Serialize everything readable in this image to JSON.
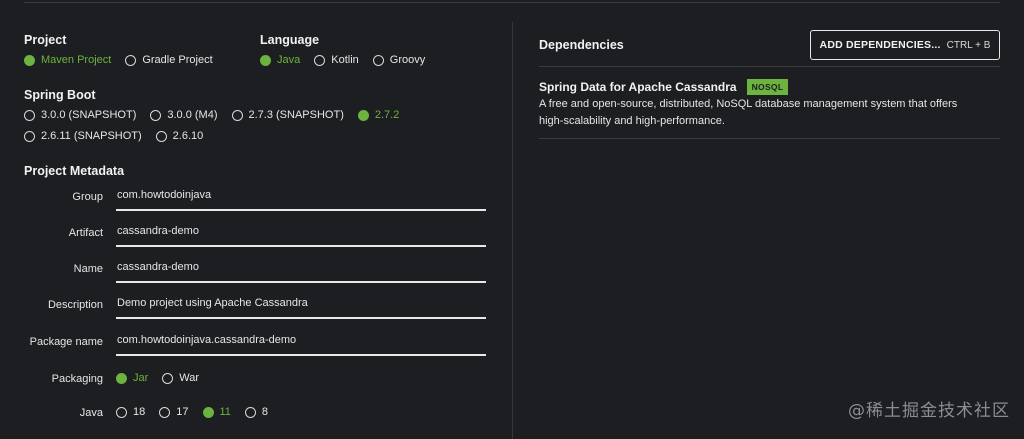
{
  "project": {
    "title": "Project",
    "options": [
      {
        "label": "Maven Project",
        "selected": true
      },
      {
        "label": "Gradle Project",
        "selected": false
      }
    ]
  },
  "language": {
    "title": "Language",
    "options": [
      {
        "label": "Java",
        "selected": true
      },
      {
        "label": "Kotlin",
        "selected": false
      },
      {
        "label": "Groovy",
        "selected": false
      }
    ]
  },
  "spring_boot": {
    "title": "Spring Boot",
    "options": [
      {
        "label": "3.0.0 (SNAPSHOT)",
        "selected": false
      },
      {
        "label": "3.0.0 (M4)",
        "selected": false
      },
      {
        "label": "2.7.3 (SNAPSHOT)",
        "selected": false
      },
      {
        "label": "2.7.2",
        "selected": true
      },
      {
        "label": "2.6.11 (SNAPSHOT)",
        "selected": false
      },
      {
        "label": "2.6.10",
        "selected": false
      }
    ]
  },
  "metadata": {
    "title": "Project Metadata",
    "fields": [
      {
        "label": "Group",
        "value": "com.howtodoinjava"
      },
      {
        "label": "Artifact",
        "value": "cassandra-demo"
      },
      {
        "label": "Name",
        "value": "cassandra-demo"
      },
      {
        "label": "Description",
        "value": "Demo project using Apache Cassandra"
      },
      {
        "label": "Package name",
        "value": "com.howtodoinjava.cassandra-demo"
      }
    ],
    "packaging": {
      "label": "Packaging",
      "options": [
        {
          "label": "Jar",
          "selected": true
        },
        {
          "label": "War",
          "selected": false
        }
      ]
    },
    "java": {
      "label": "Java",
      "options": [
        {
          "label": "18",
          "selected": false
        },
        {
          "label": "17",
          "selected": false
        },
        {
          "label": "11",
          "selected": true
        },
        {
          "label": "8",
          "selected": false
        }
      ]
    }
  },
  "dependencies": {
    "title": "Dependencies",
    "add_button_label": "ADD DEPENDENCIES...",
    "add_button_shortcut": "CTRL + B",
    "items": [
      {
        "name": "Spring Data for Apache Cassandra",
        "badge": "NOSQL",
        "description": "A free and open-source, distributed, NoSQL database management system that offers high-scalability and high-performance."
      }
    ]
  },
  "watermark": "@稀土掘金技术社区",
  "colors": {
    "background": "#1c1e21",
    "accent": "#6db33f",
    "text": "#e6e6e6"
  }
}
